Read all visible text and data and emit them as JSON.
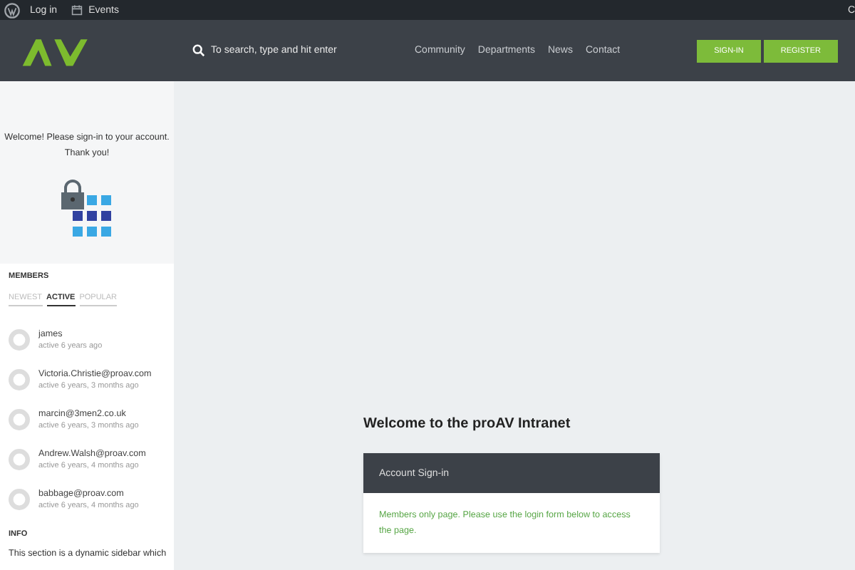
{
  "admin_bar": {
    "items": [
      {
        "label": "Log in"
      },
      {
        "label": "Events"
      }
    ],
    "edge_text": "C"
  },
  "header": {
    "search": {
      "placeholder": "To search, type and hit enter"
    },
    "nav": [
      "Community",
      "Departments",
      "News",
      "Contact"
    ],
    "buttons": [
      "SIGN-IN",
      "REGISTER"
    ]
  },
  "sidebar": {
    "welcome": "Welcome! Please sign-in to your account. Thank you!",
    "members": {
      "title": "MEMBERS",
      "tabs": [
        {
          "label": "NEWEST",
          "selected": false
        },
        {
          "label": "ACTIVE",
          "selected": true
        },
        {
          "label": "POPULAR",
          "selected": false
        }
      ],
      "list": [
        {
          "name": "james",
          "activity": "active 6 years ago"
        },
        {
          "name": "Victoria.Christie@proav.com",
          "activity": "active 6 years, 3 months ago"
        },
        {
          "name": "marcin@3men2.co.uk",
          "activity": "active 6 years, 3 months ago"
        },
        {
          "name": "Andrew.Walsh@proav.com",
          "activity": "active 6 years, 4 months ago"
        },
        {
          "name": "babbage@proav.com",
          "activity": "active 6 years, 4 months ago"
        }
      ]
    },
    "info": {
      "title": "INFO",
      "text": "This section is a dynamic sidebar which"
    }
  },
  "main": {
    "heading": "Welcome to the proAV Intranet",
    "card": {
      "title": "Account Sign-in",
      "message": "Members only page. Please use the login form below to access the page."
    }
  }
}
